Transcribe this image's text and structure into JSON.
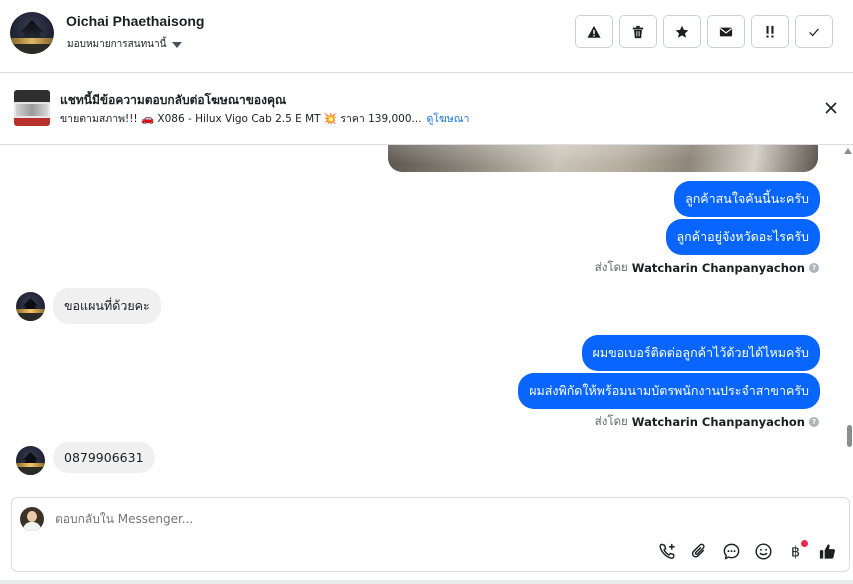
{
  "header": {
    "name": "Oichai Phaethaisong",
    "assign_label": "มอบหมายการสนทนานี้",
    "actions": [
      "report-icon",
      "trash-icon",
      "star-icon",
      "mail-icon",
      "priority-icon",
      "check-icon"
    ]
  },
  "ad": {
    "title": "แชทนี้มีข้อความตอบกลับต่อโฆษณาของคุณ",
    "subtitle": "ขายตามสภาพ!!! 🚗 X086 - Hilux Vigo Cab 2.5 E MT 💥 ราคา 139,000...",
    "link": "ดูโฆษณา"
  },
  "messages": {
    "out1": "ลูกค้าสนใจคันนี้นะครับ",
    "out2": "ลูกค้าอยู่จังหวัดอะไรครับ",
    "sent_by_prefix_1": "ส่งโดย",
    "sent_by_name_1": "Watcharin Chanpanyachon",
    "in1": "ขอแผนที่ด้วยคะ",
    "out3": "ผมขอเบอร์ติดต่อลูกค้าไว้ด้วยได้ไหมครับ",
    "out4": "ผมส่งพิกัดให้พร้อมนามบัตรพนักงานประจำสาขาครับ",
    "sent_by_prefix_2": "ส่งโดย",
    "sent_by_name_2": "Watcharin Chanpanyachon",
    "in2": "0879906631"
  },
  "composer": {
    "placeholder": "ตอบกลับใน Messenger...",
    "tools": [
      "call-add-icon",
      "attach-icon",
      "chat-icon",
      "emoji-icon",
      "baht-icon",
      "like-icon"
    ]
  },
  "colors": {
    "accent": "#0866ff",
    "incoming_bubble": "#f0f0f0",
    "link": "#1b74e4",
    "badge": "#f02849"
  }
}
